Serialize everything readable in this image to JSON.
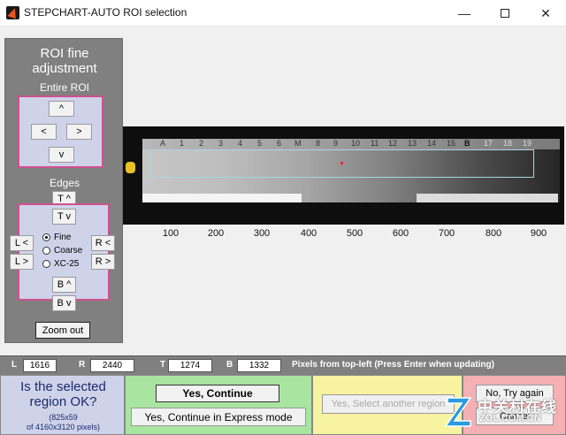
{
  "window": {
    "title": "STEPCHART-AUTO ROI selection",
    "controls": {
      "minimize": "—",
      "close": "✕"
    }
  },
  "left_panel": {
    "title_line1": "ROI fine",
    "title_line2": "adjustment",
    "entire_label": "Entire ROI",
    "entire_buttons": {
      "up": "^",
      "left": "<",
      "right": ">",
      "down": "v"
    },
    "edges_label": "Edges",
    "edge_buttons": {
      "t_up": "T ^",
      "t_down": "T v",
      "l_left": "L <",
      "l_right": "L >",
      "r_left": "R <",
      "r_right": "R >",
      "b_up": "B ^",
      "b_down": "B v"
    },
    "step_options": [
      "Fine",
      "Coarse",
      "XC-25"
    ],
    "selected_step": "Fine",
    "zoom_out": "Zoom out"
  },
  "image": {
    "ruler_marks": [
      "A",
      "1",
      "2",
      "3",
      "4",
      "5",
      "6",
      "M",
      "8",
      "9",
      "10",
      "11",
      "12",
      "13",
      "14",
      "15",
      "B",
      "17",
      "18",
      "19"
    ],
    "axis_ticks": [
      "100",
      "200",
      "300",
      "400",
      "500",
      "600",
      "700",
      "800",
      "900"
    ]
  },
  "status": {
    "l_label": "L",
    "l_value": "1616",
    "r_label": "R",
    "r_value": "2440",
    "t_label": "T",
    "t_value": "1274",
    "b_label": "B",
    "b_value": "1332",
    "hint": "Pixels from top-left  (Press Enter when updating)"
  },
  "bottom": {
    "question_line1": "Is the selected",
    "question_line2": "region OK?",
    "size_line1": "(825x59",
    "size_line2": "of 4160x3120 pixels)",
    "yes_continue": "Yes, Continue",
    "yes_express": "Yes, Continue in Express mode",
    "yes_select_another": "Yes, Select another region",
    "no_try_again": "No, Try again",
    "cancel": "Cancel"
  },
  "watermark": {
    "cn": "中关村在线",
    "en": "ZOL.COM.CN"
  },
  "colors": {
    "panel_gray": "#808080",
    "pink_border": "#d0508f",
    "lavender": "#cfd3ea",
    "green": "#a8e5a0",
    "yellow": "#f7f3a0",
    "pink": "#f4b0b3"
  }
}
